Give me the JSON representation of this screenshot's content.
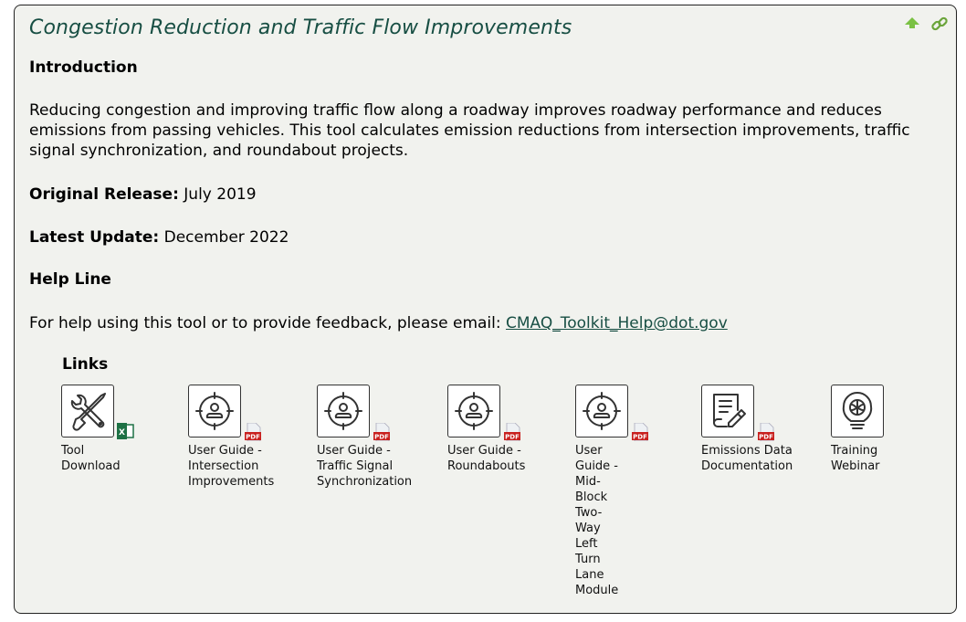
{
  "header": {
    "title": "Congestion Reduction and Traffic Flow Improvements",
    "icons": [
      "back-to-top-arrow-icon",
      "permalink-chain-icon"
    ]
  },
  "intro": {
    "heading": "Introduction",
    "body": "Reducing congestion and improving traffic flow along a roadway improves roadway performance and reduces emissions from passing vehicles. This tool calculates emission reductions from intersection improvements, traffic signal synchronization, and roundabout projects."
  },
  "release": {
    "original_label": "Original Release:",
    "original_value": "July 2019",
    "latest_label": "Latest Update:",
    "latest_value": "December 2022"
  },
  "help": {
    "heading": "Help Line",
    "text": "For help using this tool or to provide feedback, please email:",
    "email": "CMAQ_Toolkit_Help@dot.gov"
  },
  "links": {
    "heading": "Links",
    "items": [
      {
        "label": "Tool Download",
        "icon": "tools-wrench-screwdriver-icon",
        "badge": "excel"
      },
      {
        "label": "User Guide - Intersection Improvements",
        "icon": "user-target-icon",
        "badge": "pdf"
      },
      {
        "label": "User Guide - Traffic Signal Synchronization",
        "icon": "user-target-icon",
        "badge": "pdf"
      },
      {
        "label": "User Guide - Roundabouts",
        "icon": "user-target-icon",
        "badge": "pdf"
      },
      {
        "label": "User Guide - Mid-Block Two-Way Left Turn Lane Module",
        "icon": "user-target-icon",
        "badge": "pdf"
      },
      {
        "label": "Emissions Data Documentation",
        "icon": "document-pencil-icon",
        "badge": "pdf"
      },
      {
        "label": "Training Webinar",
        "icon": "lightbulb-brain-icon",
        "badge": ""
      }
    ]
  },
  "colors": {
    "title": "#174e43",
    "panel_bg": "#f1f2ee",
    "accent_green": "#7ac143",
    "pdf_red": "#c8201e",
    "excel_green": "#1e7145"
  }
}
